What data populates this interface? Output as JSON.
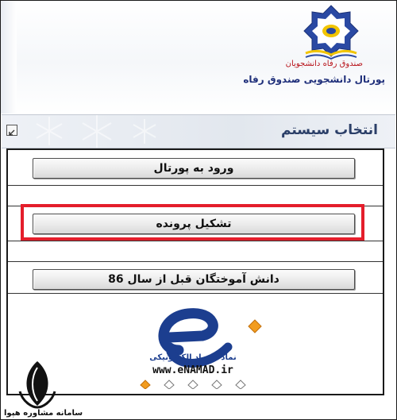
{
  "header": {
    "org_name": "صندوق رفاه دانشجویان",
    "portal_name": "پورتال دانشجویی صندوق رفاه"
  },
  "section": {
    "title": "انتخاب سیستم"
  },
  "menu": {
    "items": [
      {
        "label": "ورود به پورتال"
      },
      {
        "label": "تشکیل پرونده"
      },
      {
        "label": "دانش آموختگان قبل از سال 86"
      }
    ]
  },
  "enamad": {
    "caption": "نماد اعتماد الکترونیکی",
    "url": "www.eNAMAD.ir"
  },
  "watermark": {
    "text": "سامانه مشاوره هپوا"
  },
  "colors": {
    "highlight": "#e41e2b",
    "title_text": "#2b3f68",
    "portal_text": "#1f2f7a",
    "enamad_blue": "#1c3e8f"
  }
}
